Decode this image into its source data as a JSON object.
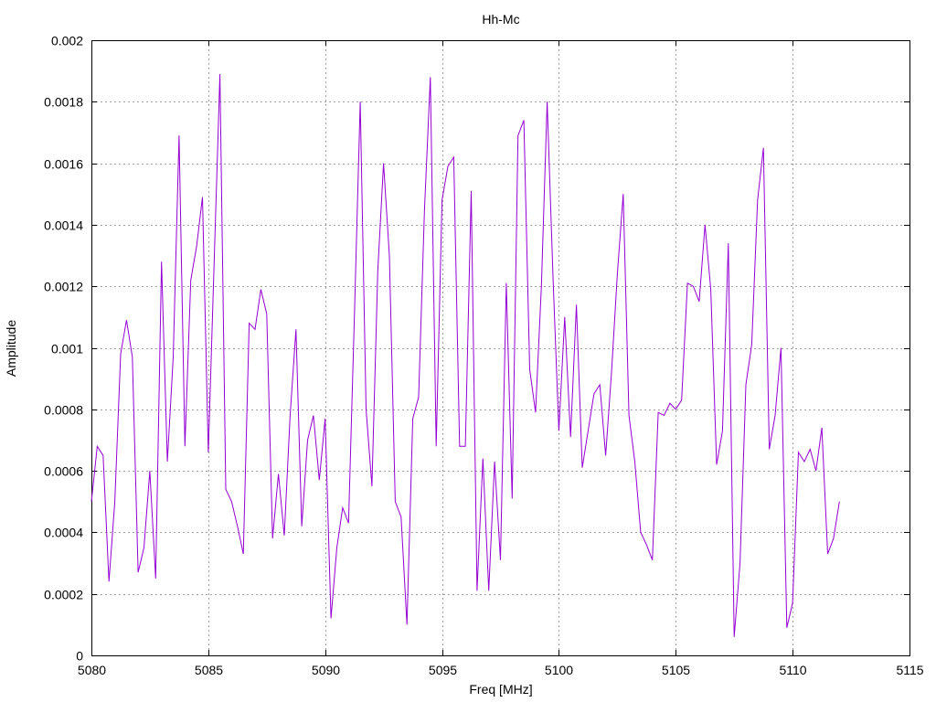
{
  "chart_data": {
    "type": "line",
    "title": "Hh-Mc",
    "xlabel": "Freq [MHz]",
    "ylabel": "Amplitude",
    "xlim": [
      5080,
      5115
    ],
    "ylim": [
      0,
      0.002
    ],
    "x_ticks": [
      "5080",
      "5085",
      "5090",
      "5095",
      "5100",
      "5105",
      "5110",
      "5115"
    ],
    "y_ticks": [
      "0",
      "0.0002",
      "0.0004",
      "0.0006",
      "0.0008",
      "0.001",
      "0.0012",
      "0.0014",
      "0.0016",
      "0.0018",
      "0.002"
    ],
    "grid": true,
    "line_color": "#9400d3",
    "series": [
      {
        "x": [
          5080.0,
          5080.25,
          5080.5,
          5080.75,
          5081.0,
          5081.25,
          5081.5,
          5081.75,
          5082.0,
          5082.25,
          5082.5,
          5082.75,
          5083.0,
          5083.25,
          5083.5,
          5083.75,
          5084.0,
          5084.25,
          5084.5,
          5084.75,
          5085.0,
          5085.25,
          5085.5,
          5085.75,
          5086.0,
          5086.25,
          5086.5,
          5086.75,
          5087.0,
          5087.25,
          5087.5,
          5087.75,
          5088.0,
          5088.25,
          5088.5,
          5088.75,
          5089.0,
          5089.25,
          5089.5,
          5089.75,
          5090.0,
          5090.25,
          5090.5,
          5090.75,
          5091.0,
          5091.25,
          5091.5,
          5091.75,
          5092.0,
          5092.25,
          5092.5,
          5092.75,
          5093.0,
          5093.25,
          5093.5,
          5093.75,
          5094.0,
          5094.25,
          5094.5,
          5094.75,
          5095.0,
          5095.25,
          5095.5,
          5095.75,
          5096.0,
          5096.25,
          5096.5,
          5096.75,
          5097.0,
          5097.25,
          5097.5,
          5097.75,
          5098.0,
          5098.25,
          5098.5,
          5098.75,
          5099.0,
          5099.25,
          5099.5,
          5099.75,
          5100.0,
          5100.25,
          5100.5,
          5100.75,
          5101.0,
          5101.25,
          5101.5,
          5101.75,
          5102.0,
          5102.25,
          5102.5,
          5102.75,
          5103.0,
          5103.25,
          5103.5,
          5103.75,
          5104.0,
          5104.25,
          5104.5,
          5104.75,
          5105.0,
          5105.25,
          5105.5,
          5105.75,
          5106.0,
          5106.25,
          5106.5,
          5106.75,
          5107.0,
          5107.25,
          5107.5,
          5107.75,
          5108.0,
          5108.25,
          5108.5,
          5108.75,
          5109.0,
          5109.25,
          5109.5,
          5109.75,
          5110.0,
          5110.25,
          5110.5,
          5110.75,
          5111.0,
          5111.25,
          5111.5,
          5111.75,
          5112.0
        ],
        "y": [
          0.0005,
          0.00068,
          0.00065,
          0.00024,
          0.0005,
          0.00098,
          0.00109,
          0.00097,
          0.00027,
          0.00035,
          0.0006,
          0.00025,
          0.00128,
          0.00063,
          0.00097,
          0.00169,
          0.00068,
          0.00122,
          0.00133,
          0.00149,
          0.00066,
          0.00128,
          0.00189,
          0.00054,
          0.0005,
          0.00042,
          0.00033,
          0.00108,
          0.00106,
          0.00119,
          0.00111,
          0.00038,
          0.00059,
          0.00039,
          0.00078,
          0.00106,
          0.00042,
          0.0007,
          0.00078,
          0.00057,
          0.00077,
          0.00012,
          0.00035,
          0.00048,
          0.00043,
          0.0011,
          0.0018,
          0.0008,
          0.00055,
          0.00125,
          0.0016,
          0.0013,
          0.0005,
          0.00045,
          0.0001,
          0.00077,
          0.00084,
          0.00145,
          0.00188,
          0.00068,
          0.00148,
          0.00159,
          0.00162,
          0.00068,
          0.00068,
          0.00151,
          0.00021,
          0.00064,
          0.00021,
          0.00063,
          0.00031,
          0.00121,
          0.00051,
          0.00169,
          0.00174,
          0.00093,
          0.00079,
          0.0012,
          0.0018,
          0.00123,
          0.00073,
          0.0011,
          0.00071,
          0.00114,
          0.00061,
          0.00073,
          0.00085,
          0.00088,
          0.00065,
          0.00092,
          0.00124,
          0.0015,
          0.00078,
          0.00063,
          0.0004,
          0.00036,
          0.00031,
          0.00079,
          0.00078,
          0.00082,
          0.0008,
          0.00083,
          0.00121,
          0.0012,
          0.00115,
          0.0014,
          0.00119,
          0.00062,
          0.00073,
          0.00134,
          6e-05,
          0.0003,
          0.00088,
          0.00101,
          0.00148,
          0.00165,
          0.00067,
          0.00078,
          0.001,
          9e-05,
          0.00017,
          0.00066,
          0.00063,
          0.00067,
          0.0006,
          0.00074,
          0.00033,
          0.00038,
          0.0005
        ]
      }
    ]
  }
}
